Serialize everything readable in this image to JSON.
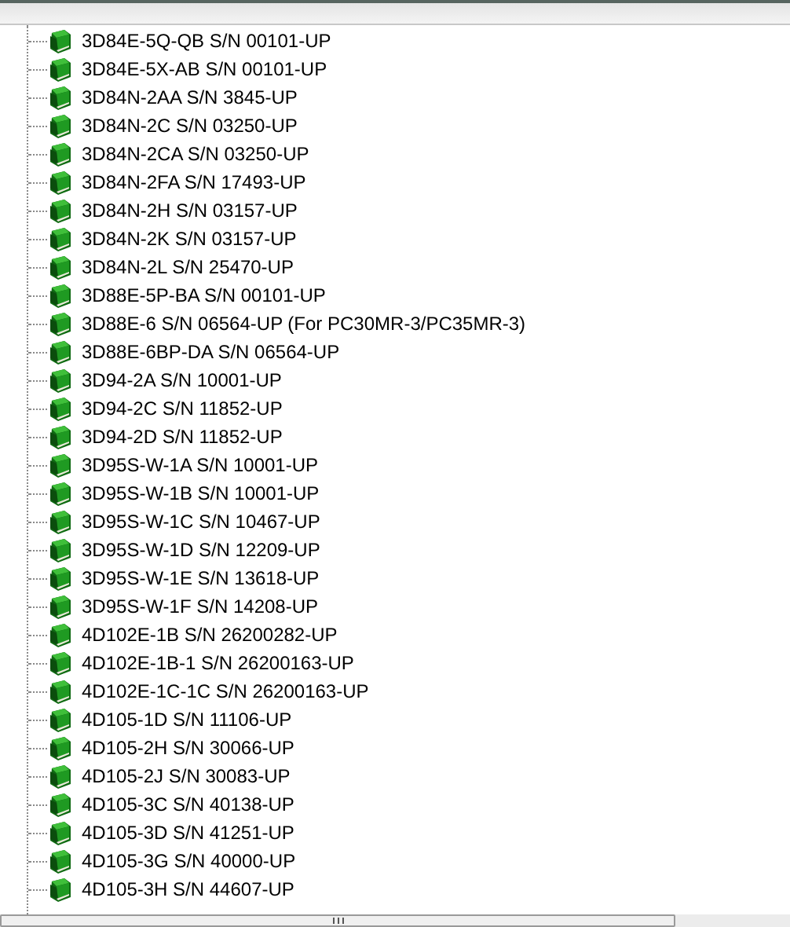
{
  "tree": {
    "items": [
      {
        "label": "3D84E-5Q-QB S/N 00101-UP"
      },
      {
        "label": "3D84E-5X-AB S/N 00101-UP"
      },
      {
        "label": "3D84N-2AA S/N 3845-UP"
      },
      {
        "label": "3D84N-2C S/N 03250-UP"
      },
      {
        "label": "3D84N-2CA S/N 03250-UP"
      },
      {
        "label": "3D84N-2FA S/N 17493-UP"
      },
      {
        "label": "3D84N-2H S/N 03157-UP"
      },
      {
        "label": "3D84N-2K S/N 03157-UP"
      },
      {
        "label": "3D84N-2L S/N 25470-UP"
      },
      {
        "label": "3D88E-5P-BA S/N 00101-UP"
      },
      {
        "label": "3D88E-6 S/N 06564-UP (For PC30MR-3/PC35MR-3)"
      },
      {
        "label": "3D88E-6BP-DA S/N 06564-UP"
      },
      {
        "label": "3D94-2A S/N 10001-UP"
      },
      {
        "label": "3D94-2C S/N 11852-UP"
      },
      {
        "label": "3D94-2D S/N 11852-UP"
      },
      {
        "label": "3D95S-W-1A S/N 10001-UP"
      },
      {
        "label": "3D95S-W-1B S/N 10001-UP"
      },
      {
        "label": "3D95S-W-1C S/N 10467-UP"
      },
      {
        "label": "3D95S-W-1D S/N 12209-UP"
      },
      {
        "label": "3D95S-W-1E S/N 13618-UP"
      },
      {
        "label": "3D95S-W-1F S/N 14208-UP"
      },
      {
        "label": "4D102E-1B S/N 26200282-UP"
      },
      {
        "label": "4D102E-1B-1 S/N 26200163-UP"
      },
      {
        "label": "4D102E-1C-1C S/N 26200163-UP"
      },
      {
        "label": "4D105-1D S/N 11106-UP"
      },
      {
        "label": "4D105-2H S/N 30066-UP"
      },
      {
        "label": "4D105-2J S/N 30083-UP"
      },
      {
        "label": "4D105-3C S/N 40138-UP"
      },
      {
        "label": "4D105-3D S/N 41251-UP"
      },
      {
        "label": "4D105-3G S/N 40000-UP"
      },
      {
        "label": "4D105-3H S/N 44607-UP"
      }
    ]
  }
}
